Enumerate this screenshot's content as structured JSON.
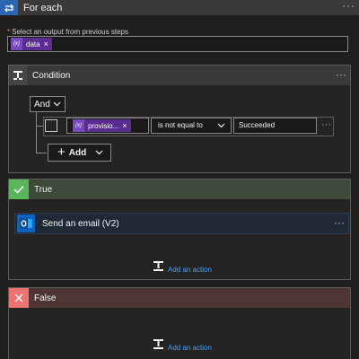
{
  "foreach": {
    "title": "For each",
    "more_label": "···",
    "output_required_marker": "*",
    "output_label": "Select an output from previous steps",
    "token_label": "data",
    "token_remove": "×"
  },
  "condition": {
    "title": "Condition",
    "more_label": "···",
    "group_operator": "And",
    "row": {
      "left_token": "provisio...",
      "left_remove": "×",
      "operator": "is not equal to",
      "right_value": "Succeeded",
      "more_label": "···"
    },
    "add_label": "Add"
  },
  "true_branch": {
    "title": "True",
    "action_title": "Send an email (V2)",
    "action_more": "···",
    "add_action_label": "Add an action"
  },
  "false_branch": {
    "title": "False",
    "add_action_label": "Add an action"
  },
  "icons": [
    "loop-icon",
    "condition-icon",
    "checkmark-icon",
    "close-icon",
    "outlook-icon",
    "add-action-icon",
    "chevron-down-icon",
    "expression-icon"
  ],
  "colors": {
    "background": "#201f1e",
    "foreach_accent": "#2b66b0",
    "token": "#5c2d91",
    "true_accent": "#5bb55b",
    "false_accent": "#ee7370",
    "link": "#479ef5",
    "outlook": "#0f62c4"
  }
}
